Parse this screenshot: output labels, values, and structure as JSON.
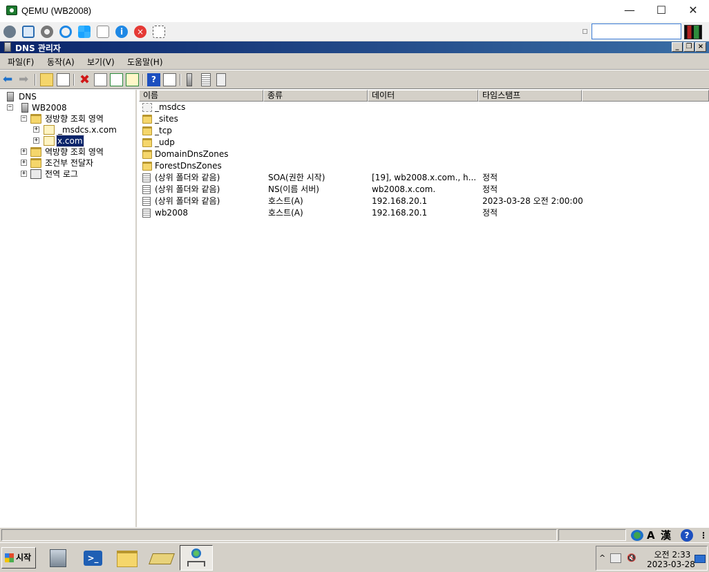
{
  "qemu": {
    "title": "QEMU (WB2008)",
    "minimize": "—",
    "maximize": "☐",
    "close": "✕",
    "toolbar_icons": [
      "connections-icon",
      "fullscreen-icon",
      "settings-icon",
      "refresh-icon",
      "windows-icon",
      "usb-icon",
      "info-icon",
      "stop-icon",
      "screenshot-icon"
    ],
    "search_value": ""
  },
  "mmc": {
    "title": "DNS 관리자",
    "menu": [
      "파일(F)",
      "동작(A)",
      "보기(V)",
      "도움말(H)"
    ],
    "toolbar_icons": [
      "back-icon",
      "forward-icon",
      "up-icon",
      "show-hide-tree-icon",
      "delete-icon",
      "properties-icon",
      "refresh-icon",
      "export-icon",
      "help-icon",
      "action-pane-icon",
      "server-icon",
      "list-icon",
      "clipboard-icon"
    ]
  },
  "tree": {
    "root": "DNS",
    "server": "WB2008",
    "forward_zones": "정방향 조회 영역",
    "zone_msdcs": "_msdcs.x.com",
    "zone_x": "x.com",
    "reverse_zones": "역방향 조회 영역",
    "conditional": "조건부 전달자",
    "global_logs": "전역 로그",
    "expand_plus": "+",
    "expand_minus": "−"
  },
  "list": {
    "columns": [
      "이름",
      "종류",
      "데이터",
      "타임스탬프"
    ],
    "rows": [
      {
        "icon": "msdcs-folder-icon",
        "name": "_msdcs",
        "type": "",
        "data": "",
        "timestamp": ""
      },
      {
        "icon": "folder-icon",
        "name": "_sites",
        "type": "",
        "data": "",
        "timestamp": ""
      },
      {
        "icon": "folder-icon",
        "name": "_tcp",
        "type": "",
        "data": "",
        "timestamp": ""
      },
      {
        "icon": "folder-icon",
        "name": "_udp",
        "type": "",
        "data": "",
        "timestamp": ""
      },
      {
        "icon": "folder-icon",
        "name": "DomainDnsZones",
        "type": "",
        "data": "",
        "timestamp": ""
      },
      {
        "icon": "folder-icon",
        "name": "ForestDnsZones",
        "type": "",
        "data": "",
        "timestamp": ""
      },
      {
        "icon": "record-icon",
        "name": "(상위 폴더와 같음)",
        "type": "SOA(권한 시작)",
        "data": "[19], wb2008.x.com., h...",
        "timestamp": "정적"
      },
      {
        "icon": "record-icon",
        "name": "(상위 폴더와 같음)",
        "type": "NS(이름 서버)",
        "data": "wb2008.x.com.",
        "timestamp": "정적"
      },
      {
        "icon": "record-icon",
        "name": "(상위 폴더와 같음)",
        "type": "호스트(A)",
        "data": "192.168.20.1",
        "timestamp": "2023-03-28 오전 2:00:00"
      },
      {
        "icon": "record-icon",
        "name": "wb2008",
        "type": "호스트(A)",
        "data": "192.168.20.1",
        "timestamp": "정적"
      }
    ]
  },
  "statusbar": {
    "ime_mode": "A",
    "ime_hanja": "漢",
    "help": "?"
  },
  "taskbar": {
    "start_label": "시작",
    "buttons": [
      "server-manager-icon",
      "powershell-icon",
      "explorer-icon",
      "notes-icon",
      "dns-manager-icon"
    ],
    "clock_time": "오전 2:33",
    "clock_date": "2023-03-28",
    "tray_expand": "^"
  }
}
